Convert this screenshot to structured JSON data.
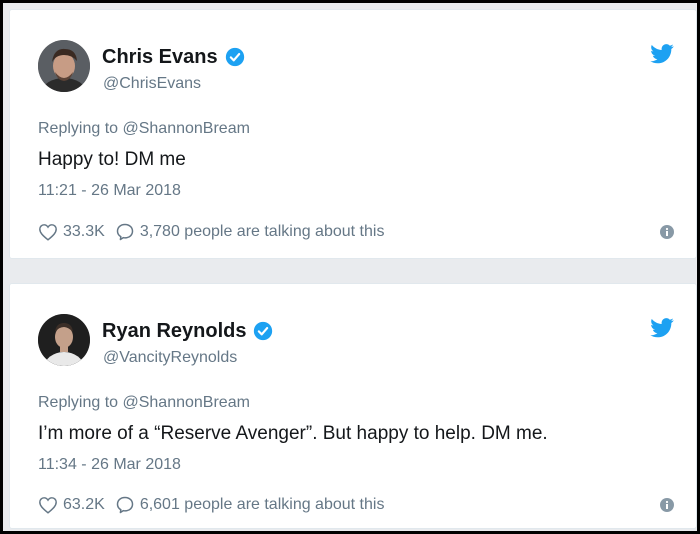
{
  "tweets": [
    {
      "display_name": "Chris Evans",
      "handle": "@ChrisEvans",
      "verified": true,
      "replying_to": "Replying to @ShannonBream",
      "text": "Happy to! DM me",
      "timestamp": "11:21 - 26 Mar 2018",
      "likes": "33.3K",
      "talking": "3,780 people are talking about this",
      "avatar_icon": "avatar-photo",
      "brand_icon": "twitter-bird-icon"
    },
    {
      "display_name": "Ryan Reynolds",
      "handle": "@VancityReynolds",
      "verified": true,
      "replying_to": "Replying to @ShannonBream",
      "text": "I’m more of a “Reserve Avenger”. But happy to help. DM me.",
      "timestamp": "11:34 - 26 Mar 2018",
      "likes": "63.2K",
      "talking": "6,601 people are talking about this",
      "avatar_icon": "avatar-photo",
      "brand_icon": "twitter-bird-icon"
    }
  ],
  "colors": {
    "text": "#14171a",
    "secondary": "#657786",
    "verified_blue": "#1da1f2",
    "twitter_blue": "#1da1f2"
  }
}
